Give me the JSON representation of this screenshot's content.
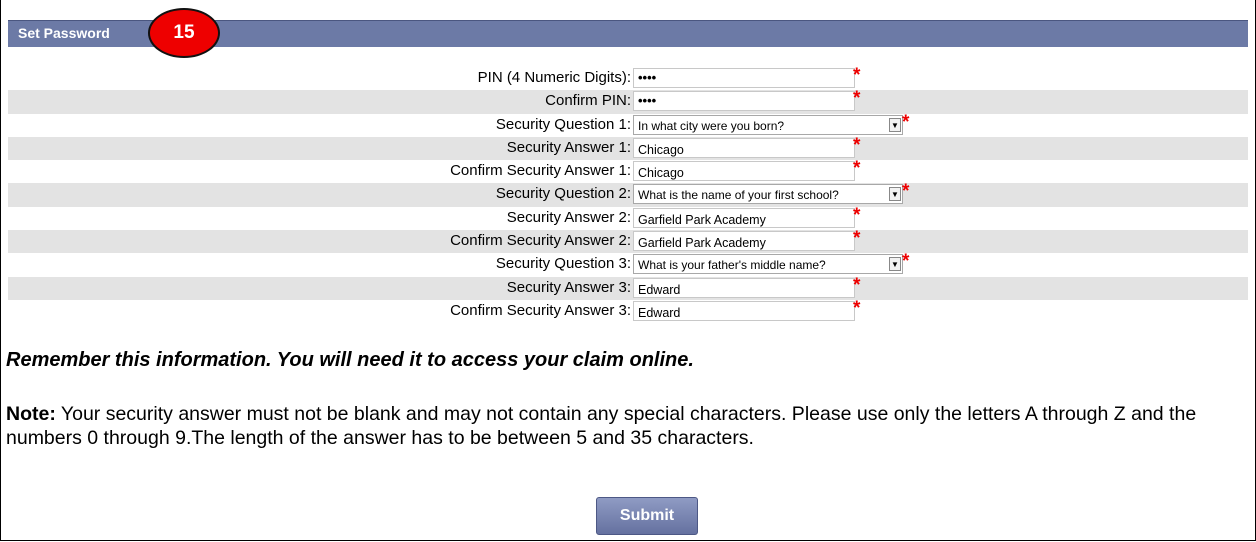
{
  "header": {
    "title": "Set Password",
    "step_badge": "15"
  },
  "form": {
    "rows": [
      {
        "label": "PIN (4 Numeric Digits):",
        "type": "password",
        "value": "••••"
      },
      {
        "label": "Confirm PIN:",
        "type": "password",
        "value": "••••"
      },
      {
        "label": "Security Question 1:",
        "type": "select",
        "value": "In what city were you born?"
      },
      {
        "label": "Security Answer 1:",
        "type": "text",
        "value": "Chicago"
      },
      {
        "label": "Confirm Security Answer 1:",
        "type": "text",
        "value": "Chicago"
      },
      {
        "label": "Security Question 2:",
        "type": "select",
        "value": "What is the name of your first school?"
      },
      {
        "label": "Security Answer 2:",
        "type": "text",
        "value": "Garfield Park Academy"
      },
      {
        "label": "Confirm Security Answer 2:",
        "type": "text",
        "value": "Garfield Park Academy"
      },
      {
        "label": "Security Question 3:",
        "type": "select",
        "value": "What is your father's middle name?"
      },
      {
        "label": "Security Answer 3:",
        "type": "text",
        "value": "Edward"
      },
      {
        "label": "Confirm Security Answer 3:",
        "type": "text",
        "value": "Edward"
      }
    ],
    "required_marker": "*"
  },
  "reminder": "Remember this information. You will need it to access your claim online.",
  "note": {
    "prefix": "Note:",
    "text": " Your security answer must not be blank and may not contain any special characters. Please use only the letters A through Z and the numbers 0 through 9.The length of the answer has to be between 5 and 35 characters."
  },
  "submit_label": "Submit",
  "colors": {
    "header_bar": "#6c7aa6",
    "row_shade": "#e3e3e3",
    "required": "#ee0000",
    "badge": "#ee0000"
  }
}
